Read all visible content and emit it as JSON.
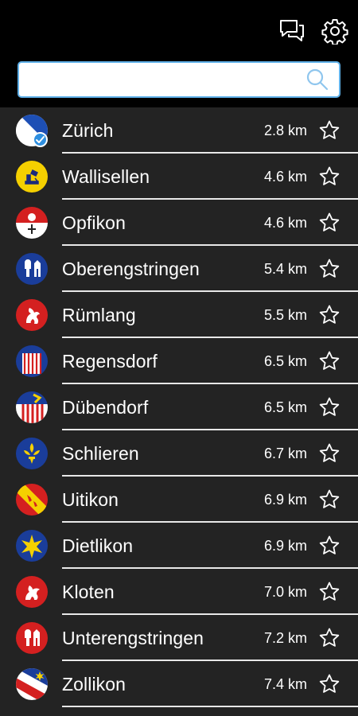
{
  "search": {
    "value": "",
    "placeholder": ""
  },
  "icons": {
    "chat": "chat-bubbles-icon",
    "settings": "gear-icon",
    "search": "search-icon",
    "favorite": "star-outline-icon"
  },
  "colors": {
    "background": "#232323",
    "topbar": "#000000",
    "accent": "#2e8fe0",
    "divider": "#e8e8e8"
  },
  "places": [
    {
      "name": "Zürich",
      "distance": "2.8 km",
      "crest": "zurich",
      "selected": true
    },
    {
      "name": "Wallisellen",
      "distance": "4.6 km",
      "crest": "wallisellen"
    },
    {
      "name": "Opfikon",
      "distance": "4.6 km",
      "crest": "opfikon"
    },
    {
      "name": "Oberengstringen",
      "distance": "5.4 km",
      "crest": "oberengstringen"
    },
    {
      "name": "Rümlang",
      "distance": "5.5 km",
      "crest": "ruemlang"
    },
    {
      "name": "Regensdorf",
      "distance": "6.5 km",
      "crest": "regensdorf"
    },
    {
      "name": "Dübendorf",
      "distance": "6.5 km",
      "crest": "duebendorf"
    },
    {
      "name": "Schlieren",
      "distance": "6.7 km",
      "crest": "schlieren"
    },
    {
      "name": "Uitikon",
      "distance": "6.9 km",
      "crest": "uitikon"
    },
    {
      "name": "Dietlikon",
      "distance": "6.9 km",
      "crest": "dietlikon"
    },
    {
      "name": "Kloten",
      "distance": "7.0 km",
      "crest": "kloten"
    },
    {
      "name": "Unterengstringen",
      "distance": "7.2 km",
      "crest": "unterengstringen"
    },
    {
      "name": "Zollikon",
      "distance": "7.4 km",
      "crest": "zollikon"
    }
  ]
}
